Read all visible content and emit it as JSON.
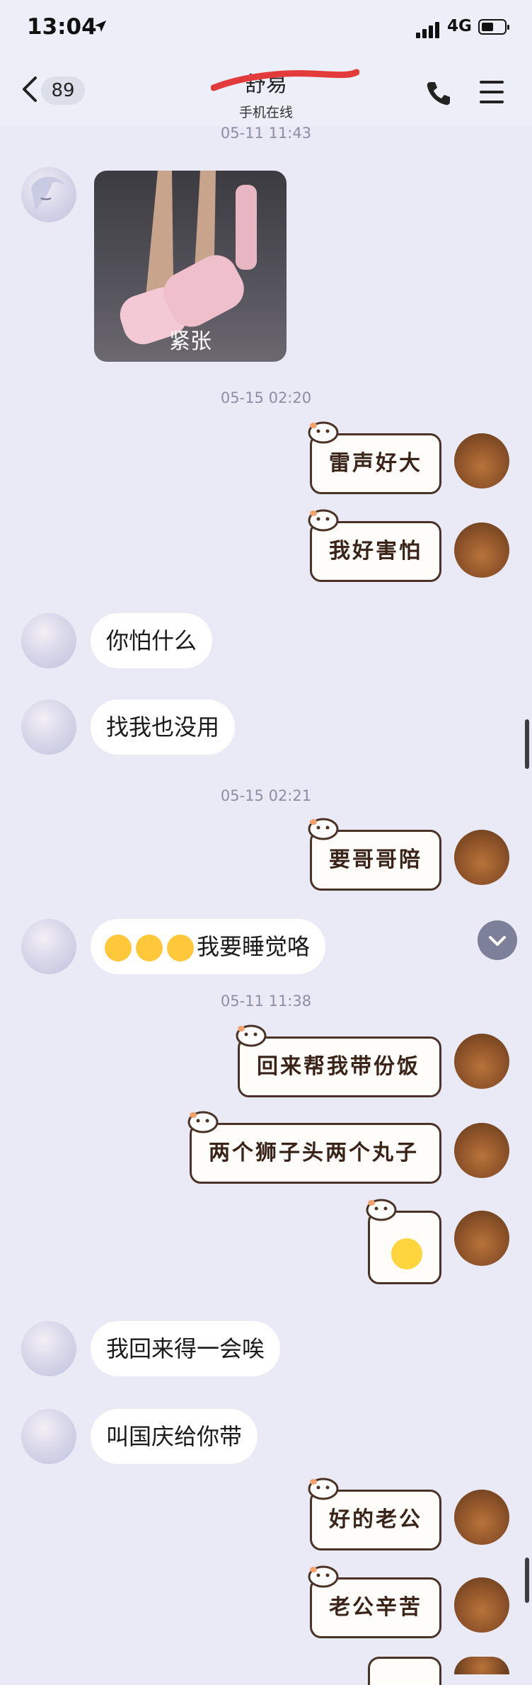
{
  "status_bar": {
    "time": "13:04",
    "network": "4G",
    "location_icon": "location-arrow-icon",
    "signal_icon": "signal-bars-icon",
    "battery_icon": "battery-icon"
  },
  "header": {
    "back_count": "89",
    "title": "舒易",
    "subtitle": "手机在线",
    "call_icon": "phone-icon",
    "menu_icon": "hamburger-menu-icon"
  },
  "messages": {
    "ts1": "05-11 11:43",
    "photo_caption": "紧张",
    "ts2": "05-15 02:20",
    "s1": "雷声好大",
    "s2": "我好害怕",
    "m1": "你怕什么",
    "m2": "找我也没用",
    "ts3": "05-15 02:21",
    "s3": "要哥哥陪",
    "m3": "我要睡觉咯",
    "ts4": "05-11 11:38",
    "s4": "回来帮我带份饭",
    "s5": "两个狮子头两个丸子",
    "m4": "我回来得一会唉",
    "m5": "叫国庆给你带",
    "s6": "好的老公",
    "s7": "老公辛苦"
  },
  "colors": {
    "background": "#e9eaf6",
    "bubble": "#ffffff",
    "sticker_border": "#4a3326",
    "timestamp": "#8a8fa3"
  }
}
